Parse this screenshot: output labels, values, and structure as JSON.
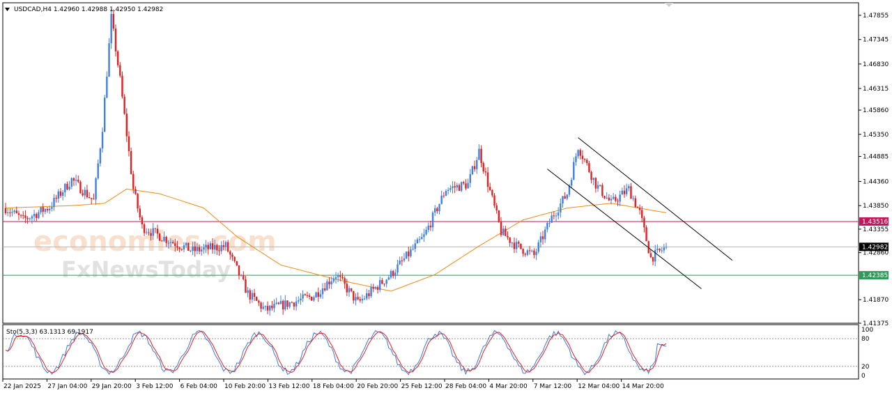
{
  "header": {
    "symbol_line": "USDCAD,H4  1.42960 1.42988 1.42950 1.42982"
  },
  "watermark": {
    "line1": "economies.com",
    "line2": "FxNewsToday"
  },
  "oscillator": {
    "label": "Sto(5,3,3) 63.1313 69.1917",
    "axis_ticks": [
      "100",
      "80",
      "20",
      "0"
    ]
  },
  "colors": {
    "bull": "#3f7fe0",
    "bear": "#e02020",
    "ma": "#f08a12",
    "resistance": "#c1185b",
    "support": "#2e9a5a",
    "stoch_main": "#3a78d8",
    "stoch_signal": "#e02020",
    "channel": "#000000",
    "current_price_bg": "#000000"
  },
  "chart_data": {
    "type": "candlestick",
    "symbol": "USDCAD",
    "timeframe": "H4",
    "ylim": [
      1.41375,
      1.48118
    ],
    "y_ticks": [
      "1.47855",
      "1.47345",
      "1.46830",
      "1.46315",
      "1.45860",
      "1.45350",
      "1.44885",
      "1.44360",
      "1.43850",
      "1.43355",
      "1.42860",
      "1.41870",
      "1.41375"
    ],
    "x_ticks": [
      "22 Jan 2025",
      "27 Jan 04:00",
      "29 Jan 20:00",
      "3 Feb 12:00",
      "6 Feb 04:00",
      "10 Feb 20:00",
      "13 Feb 12:00",
      "18 Feb 04:00",
      "20 Feb 20:00",
      "25 Feb 12:00",
      "28 Feb 04:00",
      "4 Mar 20:00",
      "7 Mar 12:00",
      "12 Mar 04:00",
      "14 Mar 20:00"
    ],
    "ohlc_anchor_closes": [
      [
        0,
        1.438
      ],
      [
        8,
        1.4355
      ],
      [
        20,
        1.4382
      ],
      [
        30,
        1.444
      ],
      [
        40,
        1.4395
      ],
      [
        44,
        1.455
      ],
      [
        48,
        1.478
      ],
      [
        52,
        1.465
      ],
      [
        58,
        1.442
      ],
      [
        62,
        1.434
      ],
      [
        75,
        1.431
      ],
      [
        85,
        1.429
      ],
      [
        100,
        1.43
      ],
      [
        110,
        1.42
      ],
      [
        118,
        1.4165
      ],
      [
        140,
        1.4195
      ],
      [
        150,
        1.424
      ],
      [
        160,
        1.418
      ],
      [
        175,
        1.424
      ],
      [
        190,
        1.432
      ],
      [
        200,
        1.442
      ],
      [
        210,
        1.443
      ],
      [
        215,
        1.45
      ],
      [
        225,
        1.433
      ],
      [
        232,
        1.43
      ],
      [
        240,
        1.428
      ],
      [
        248,
        1.436
      ],
      [
        255,
        1.441
      ],
      [
        260,
        1.451
      ],
      [
        268,
        1.443
      ],
      [
        275,
        1.439
      ],
      [
        283,
        1.442
      ],
      [
        288,
        1.437
      ],
      [
        293,
        1.4275
      ],
      [
        300,
        1.4298
      ]
    ],
    "last_close": 1.42982,
    "moving_average_points": [
      [
        0,
        1.438
      ],
      [
        30,
        1.4385
      ],
      [
        45,
        1.439
      ],
      [
        55,
        1.442
      ],
      [
        70,
        1.441
      ],
      [
        90,
        1.438
      ],
      [
        105,
        1.432
      ],
      [
        125,
        1.426
      ],
      [
        150,
        1.423
      ],
      [
        175,
        1.4205
      ],
      [
        195,
        1.424
      ],
      [
        215,
        1.43
      ],
      [
        235,
        1.4355
      ],
      [
        255,
        1.438
      ],
      [
        275,
        1.439
      ],
      [
        300,
        1.437
      ]
    ],
    "horizontal_levels": [
      {
        "value": 1.43516,
        "label": "1.43516"
      },
      {
        "value": 1.42385,
        "label": "1.42385"
      }
    ],
    "current_price_label": "1.42982",
    "trend_channel": {
      "upper": [
        [
          260,
          1.4528
        ],
        [
          330,
          1.427
        ]
      ],
      "lower": [
        [
          246,
          1.4462
        ],
        [
          316,
          1.421
        ]
      ]
    },
    "stochastic": {
      "k_period": 5,
      "d_period": 3,
      "slowing": 3,
      "main": 63.1313,
      "signal": 69.1917,
      "levels": [
        80,
        20
      ]
    }
  }
}
